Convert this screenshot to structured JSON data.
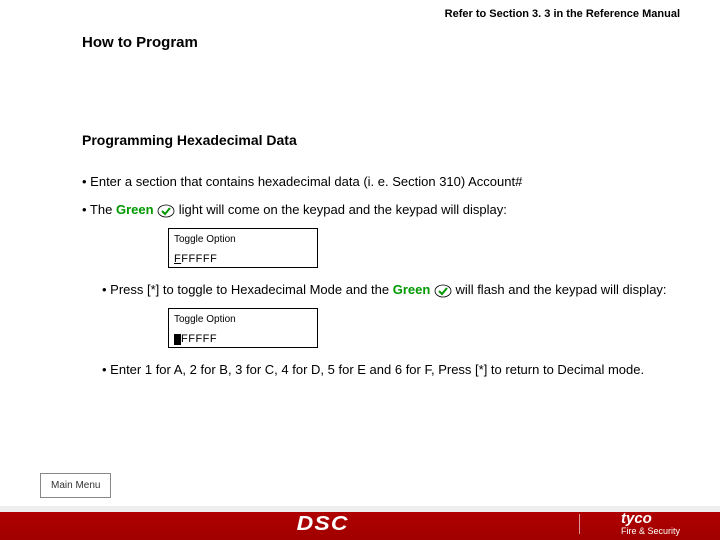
{
  "top_reference": "Refer to Section 3. 3 in the Reference Manual",
  "title": "How to Program",
  "subtitle": "Programming Hexadecimal Data",
  "bullet1": "• Enter a section that contains hexadecimal data (i. e. Section 310) Account#",
  "bullet2_pre": "• The ",
  "green_word": "Green",
  "bullet2_post": " light will come on the keypad and the keypad will display:",
  "lcd1_line1": "Toggle Option",
  "lcd1_line2": "FFFFFF",
  "bullet3_pre": "•  Press [*] to toggle to Hexadecimal Mode and the ",
  "bullet3_post": " will flash and the keypad will display:",
  "lcd2_line1": "Toggle Option",
  "lcd2_line2_rest": "FFFFF",
  "bullet4": "•  Enter 1 for A, 2 for B, 3 for C, 4 for D, 5 for E and 6 for F, Press [*] to return to Decimal mode.",
  "main_menu": "Main Menu",
  "footer": {
    "dsc": "DSC",
    "tyco_brand": "tyco",
    "tyco_sub": "Fire & Security"
  }
}
